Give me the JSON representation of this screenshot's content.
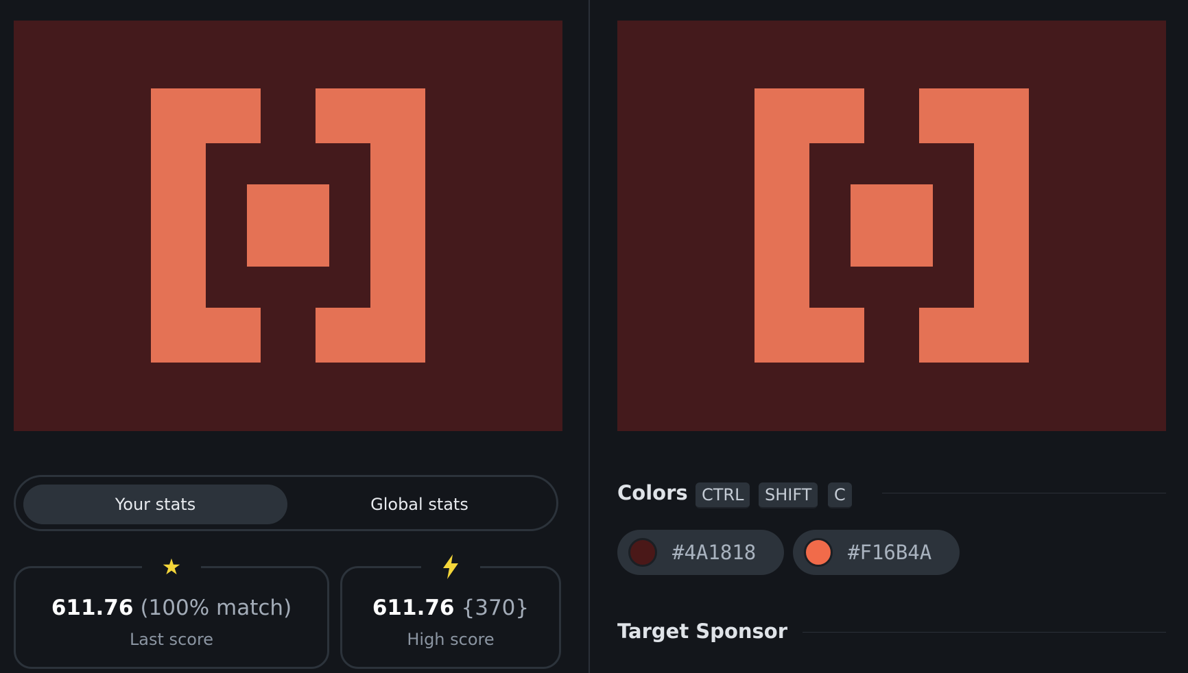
{
  "colors": {
    "background": "#4A1818",
    "foreground": "#F16B4A"
  },
  "target_canvas": {
    "name": "target-image"
  },
  "output_canvas": {
    "name": "output-image"
  },
  "stats_tabs": {
    "your_stats": "Your stats",
    "global_stats": "Global stats"
  },
  "last_score": {
    "icon": "star-icon",
    "value": "611.76",
    "detail": "(100% match)",
    "label": "Last score"
  },
  "high_score": {
    "icon": "lightning-icon",
    "value": "611.76",
    "detail": "{370}",
    "label": "High score"
  },
  "colors_section": {
    "title": "Colors",
    "shortcut": [
      "CTRL",
      "SHIFT",
      "C"
    ],
    "swatches": [
      "#4A1818",
      "#F16B4A"
    ]
  },
  "sponsor_section": {
    "title": "Target Sponsor"
  }
}
